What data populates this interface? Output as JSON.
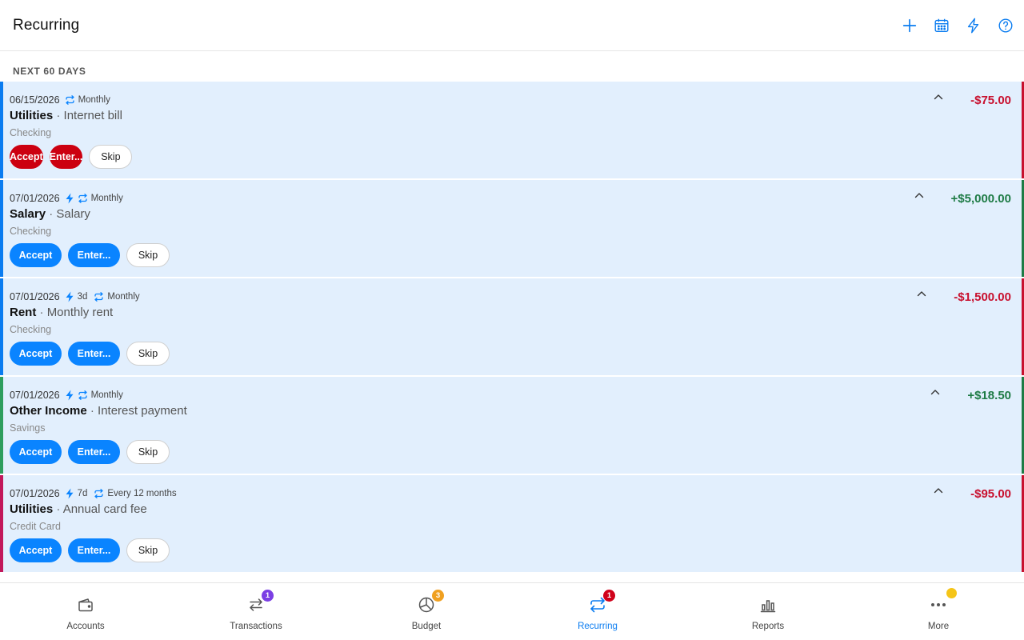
{
  "header": {
    "title": "Recurring"
  },
  "section": {
    "label": "NEXT 60 DAYS"
  },
  "items": [
    {
      "date": "06/15/2026",
      "auto": false,
      "lead": "",
      "frequency": "Monthly",
      "category": "Utilities",
      "sep": " · ",
      "description": "Internet bill",
      "account": "Checking",
      "amount": "-$75.00",
      "sign": "neg",
      "overdue": true,
      "accent": "#0a7cf0",
      "edge": "#c8102e",
      "accept_label": "Accept",
      "enter_label": "Enter...",
      "skip_label": "Skip"
    },
    {
      "date": "07/01/2026",
      "auto": true,
      "lead": "",
      "frequency": "Monthly",
      "category": "Salary",
      "sep": " · ",
      "description": "Salary",
      "account": "Checking",
      "amount": "+$5,000.00",
      "sign": "pos",
      "overdue": false,
      "accent": "#0a7cf0",
      "edge": "#1e7b45",
      "accept_label": "Accept",
      "enter_label": "Enter...",
      "skip_label": "Skip"
    },
    {
      "date": "07/01/2026",
      "auto": true,
      "lead": "3d",
      "frequency": "Monthly",
      "category": "Rent",
      "sep": " · ",
      "description": "Monthly rent",
      "account": "Checking",
      "amount": "-$1,500.00",
      "sign": "neg",
      "overdue": false,
      "accent": "#0a7cf0",
      "edge": "#c8102e",
      "accept_label": "Accept",
      "enter_label": "Enter...",
      "skip_label": "Skip"
    },
    {
      "date": "07/01/2026",
      "auto": true,
      "lead": "",
      "frequency": "Monthly",
      "category": "Other Income",
      "sep": " · ",
      "description": "Interest payment",
      "account": "Savings",
      "amount": "+$18.50",
      "sign": "pos",
      "overdue": false,
      "accent": "#2e9e5e",
      "edge": "#1e7b45",
      "accept_label": "Accept",
      "enter_label": "Enter...",
      "skip_label": "Skip"
    },
    {
      "date": "07/01/2026",
      "auto": true,
      "lead": "7d",
      "frequency": "Every 12 months",
      "category": "Utilities",
      "sep": " · ",
      "description": "Annual card fee",
      "account": "Credit Card",
      "amount": "-$95.00",
      "sign": "neg",
      "overdue": false,
      "accent": "#c2185b",
      "edge": "#c8102e",
      "accept_label": "Accept",
      "enter_label": "Enter...",
      "skip_label": "Skip"
    }
  ],
  "tabs": [
    {
      "key": "accounts",
      "label": "Accounts",
      "badge": "",
      "badge_color": ""
    },
    {
      "key": "transactions",
      "label": "Transactions",
      "badge": "1",
      "badge_color": "#7b3fe4"
    },
    {
      "key": "budget",
      "label": "Budget",
      "badge": "3",
      "badge_color": "#f0a020"
    },
    {
      "key": "recurring",
      "label": "Recurring",
      "badge": "1",
      "badge_color": "#d0021b"
    },
    {
      "key": "reports",
      "label": "Reports",
      "badge": "",
      "badge_color": ""
    },
    {
      "key": "more",
      "label": "More",
      "badge": "",
      "badge_color": "#f5c518"
    }
  ],
  "colors": {
    "accent": "#0a84ff",
    "danger": "#cc0010",
    "positive": "#1e7b45",
    "negative": "#c8102e",
    "card_bg": "#e2effd"
  }
}
